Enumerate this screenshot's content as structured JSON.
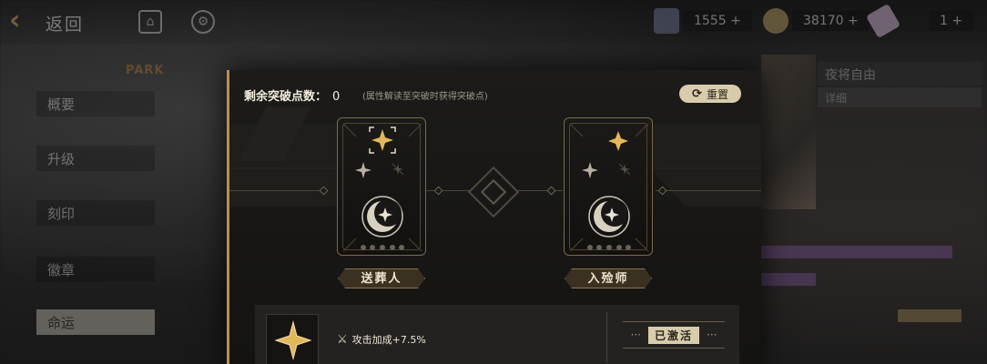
{
  "background": {
    "topbar": {
      "back_label": "返回",
      "resource_1": "1555 +",
      "resource_2": "38170 +",
      "resource_3": "1 +"
    },
    "left_menu": {
      "park_label": "PARK",
      "items": [
        "概要",
        "升级",
        "刻印",
        "徽章",
        "命运"
      ]
    },
    "right_panel": {
      "title": "夜将自由",
      "subtitle": "详细"
    }
  },
  "dialog": {
    "points_label": "剩余突破点数：",
    "points_value": "0",
    "points_hint": "(属性解读至突破时获得突破点)",
    "reset_label": "重置",
    "cards": [
      {
        "name": "送葬人"
      },
      {
        "name": "入殓师"
      }
    ],
    "skill": {
      "description": "攻击加成+7.5%",
      "status_label": "已激活",
      "status_dots_left": "···",
      "status_dots_right": "···"
    }
  },
  "colors": {
    "accent_gold": "#b8914d",
    "badge_bg": "#d9ccac",
    "dialog_bg": "#1c1b19"
  }
}
